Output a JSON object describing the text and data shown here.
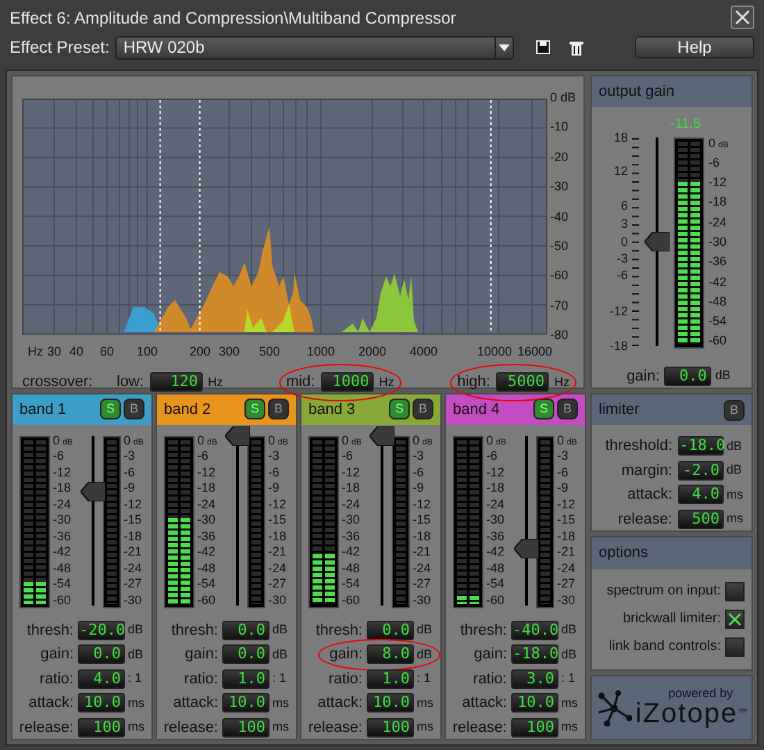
{
  "window": {
    "title": "Effect 6: Amplitude and Compression\\Multiband Compressor"
  },
  "preset": {
    "label": "Effect Preset:",
    "value": "HRW 020b"
  },
  "help_button": "Help",
  "spectrum": {
    "y_labels": [
      "0 dB",
      "-10",
      "-20",
      "-30",
      "-40",
      "-50",
      "-60",
      "-70",
      "-80"
    ],
    "x_labels": [
      "Hz",
      "30",
      "40",
      "60",
      "100",
      "200",
      "300",
      "500",
      "1000",
      "2000",
      "4000",
      "10000",
      "16000"
    ]
  },
  "crossover": {
    "label": "crossover:",
    "points": [
      {
        "label": "low:",
        "value": "120",
        "unit": "Hz",
        "circled": false
      },
      {
        "label": "mid:",
        "value": "1000",
        "unit": "Hz",
        "circled": true
      },
      {
        "label": "high:",
        "value": "5000",
        "unit": "Hz",
        "circled": true
      }
    ]
  },
  "bands": [
    {
      "title": "band 1",
      "color": "#3c9ec6",
      "s_button": {
        "label": "S",
        "on": true
      },
      "b_button": {
        "label": "B",
        "on": false
      },
      "input_meter": {
        "level": 0.13
      },
      "thresh_slider": {
        "level": 0.67
      },
      "scales": {
        "input": [
          "0",
          "-6",
          "-12",
          "-18",
          "-24",
          "-30",
          "-36",
          "-42",
          "-48",
          "-54",
          "-60"
        ],
        "input_top_unit": "dB",
        "gr": [
          "0",
          "-3",
          "-6",
          "-9",
          "-12",
          "-15",
          "-18",
          "-21",
          "-24",
          "-27",
          "-30"
        ],
        "gr_top_unit": "dB"
      },
      "params": [
        {
          "label": "thresh:",
          "value": "-20.0",
          "unit": "dB",
          "circled": false
        },
        {
          "label": "gain:",
          "value": "0.0",
          "unit": "dB",
          "circled": false
        },
        {
          "label": "ratio:",
          "value": "4.0",
          "unit": ": 1",
          "circled": false
        },
        {
          "label": "attack:",
          "value": "10.0",
          "unit": "ms",
          "circled": false
        },
        {
          "label": "release:",
          "value": "100",
          "unit": "ms",
          "circled": false
        }
      ]
    },
    {
      "title": "band 2",
      "color": "#e8931c",
      "s_button": {
        "label": "S",
        "on": true
      },
      "b_button": {
        "label": "B",
        "on": false
      },
      "input_meter": {
        "level": 0.52
      },
      "thresh_slider": {
        "level": 1
      },
      "scales": {
        "input": [
          "0",
          "-6",
          "-12",
          "-18",
          "-24",
          "-30",
          "-36",
          "-42",
          "-48",
          "-54",
          "-60"
        ],
        "input_top_unit": "dB",
        "gr": [
          "0",
          "-3",
          "-6",
          "-9",
          "-12",
          "-15",
          "-18",
          "-21",
          "-24",
          "-27",
          "-30"
        ],
        "gr_top_unit": "dB"
      },
      "params": [
        {
          "label": "thresh:",
          "value": "0.0",
          "unit": "dB",
          "circled": false
        },
        {
          "label": "gain:",
          "value": "0.0",
          "unit": "dB",
          "circled": false
        },
        {
          "label": "ratio:",
          "value": "1.0",
          "unit": ": 1",
          "circled": false
        },
        {
          "label": "attack:",
          "value": "10.0",
          "unit": "ms",
          "circled": false
        },
        {
          "label": "release:",
          "value": "100",
          "unit": "ms",
          "circled": false
        }
      ]
    },
    {
      "title": "band 3",
      "color": "#88a83a",
      "s_button": {
        "label": "S",
        "on": true
      },
      "b_button": {
        "label": "B",
        "on": false
      },
      "input_meter": {
        "level": 0.3
      },
      "thresh_slider": {
        "level": 1
      },
      "scales": {
        "input": [
          "0",
          "-6",
          "-12",
          "-18",
          "-24",
          "-30",
          "-36",
          "-42",
          "-48",
          "-54",
          "-60"
        ],
        "input_top_unit": "dB",
        "gr": [
          "0",
          "-3",
          "-6",
          "-9",
          "-12",
          "-15",
          "-18",
          "-21",
          "-24",
          "-27",
          "-30"
        ],
        "gr_top_unit": "dB"
      },
      "params": [
        {
          "label": "thresh:",
          "value": "0.0",
          "unit": "dB",
          "circled": false
        },
        {
          "label": "gain:",
          "value": "8.0",
          "unit": "dB",
          "circled": true
        },
        {
          "label": "ratio:",
          "value": "1.0",
          "unit": ": 1",
          "circled": false
        },
        {
          "label": "attack:",
          "value": "10.0",
          "unit": "ms",
          "circled": false
        },
        {
          "label": "release:",
          "value": "100",
          "unit": "ms",
          "circled": false
        }
      ]
    },
    {
      "title": "band 4",
      "color": "#c24cc2",
      "s_button": {
        "label": "S",
        "on": true
      },
      "b_button": {
        "label": "B",
        "on": false
      },
      "input_meter": {
        "level": 0.05
      },
      "thresh_slider": {
        "level": 0.33
      },
      "scales": {
        "input": [
          "0",
          "-6",
          "-12",
          "-18",
          "-24",
          "-30",
          "-36",
          "-42",
          "-48",
          "-54",
          "-60"
        ],
        "input_top_unit": "dB",
        "gr": [
          "0",
          "-3",
          "-6",
          "-9",
          "-12",
          "-15",
          "-18",
          "-21",
          "-24",
          "-27",
          "-30"
        ],
        "gr_top_unit": "dB"
      },
      "params": [
        {
          "label": "thresh:",
          "value": "-40.0",
          "unit": "dB",
          "circled": false
        },
        {
          "label": "gain:",
          "value": "-18.0",
          "unit": "dB",
          "circled": false
        },
        {
          "label": "ratio:",
          "value": "3.0",
          "unit": ": 1",
          "circled": false
        },
        {
          "label": "attack:",
          "value": "10.0",
          "unit": "ms",
          "circled": false
        },
        {
          "label": "release:",
          "value": "100",
          "unit": "ms",
          "circled": false
        }
      ]
    }
  ],
  "output_gain": {
    "title": "output gain",
    "reading": "-11.5",
    "gain_scale": [
      "18",
      "12",
      "6",
      "3",
      "0",
      "-3",
      "-6",
      "-12",
      "-18"
    ],
    "meter_scale": [
      "0",
      "-6",
      "-12",
      "-18",
      "-24",
      "-30",
      "-36",
      "-42",
      "-48",
      "-54",
      "-60"
    ],
    "meter_top_unit": "dB",
    "slider": {
      "level": 0.5
    },
    "meter": {
      "level": 0.8
    },
    "gain_label": "gain:",
    "gain_value": "0.0",
    "gain_unit": "dB"
  },
  "limiter": {
    "title": "limiter",
    "b_button": {
      "label": "B",
      "on": false
    },
    "params": [
      {
        "label": "threshold:",
        "value": "-18.0",
        "unit": "dB"
      },
      {
        "label": "margin:",
        "value": "-2.0",
        "unit": "dB"
      },
      {
        "label": "attack:",
        "value": "4.0",
        "unit": "ms"
      },
      {
        "label": "release:",
        "value": "500",
        "unit": "ms"
      }
    ]
  },
  "options": {
    "title": "options",
    "items": [
      {
        "label": "spectrum on input:",
        "checked": false
      },
      {
        "label": "brickwall limiter:",
        "checked": true
      },
      {
        "label": "link band controls:",
        "checked": false
      }
    ]
  },
  "logo": {
    "tagline": "powered by",
    "brand": "iZotope",
    "mark": "tm"
  }
}
